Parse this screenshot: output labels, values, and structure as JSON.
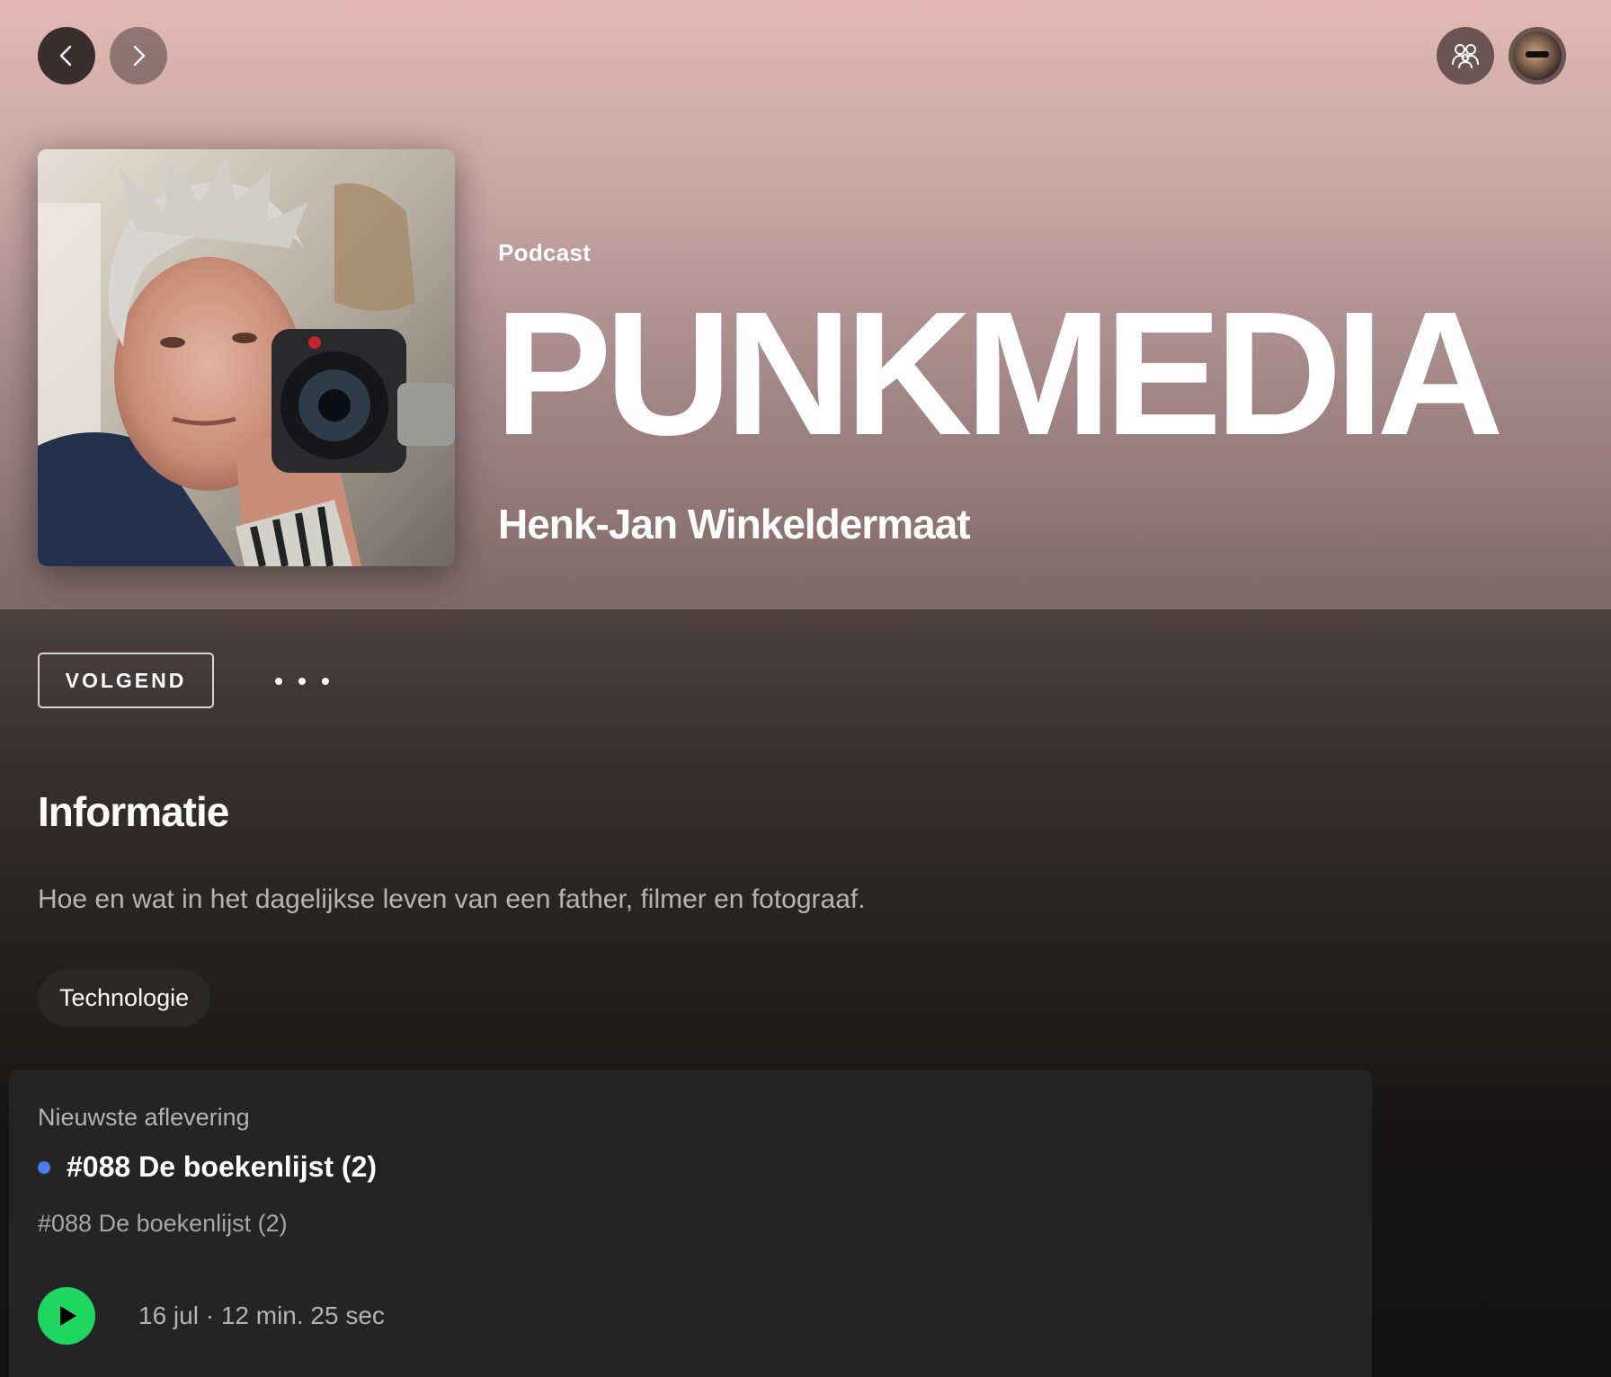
{
  "nav": {
    "back_icon": "chevron-left-icon",
    "forward_icon": "chevron-right-icon",
    "friends_icon": "friends-activity-icon",
    "profile_icon": "user-avatar"
  },
  "header": {
    "type_label": "Podcast",
    "title": "PUNKMEDIA",
    "author": "Henk-Jan Winkeldermaat",
    "gradient_top": "#e3b9b2",
    "gradient_bottom": "#806868"
  },
  "actions": {
    "follow_label": "VOLGEND",
    "more_icon": "more-options-icon"
  },
  "info": {
    "heading": "Informatie",
    "description": "Hoe en wat in het dagelijkse leven van een father, filmer en fotograaf.",
    "category": "Technologie"
  },
  "latest_episode": {
    "caption": "Nieuwste aflevering",
    "title": "#088 De boekenlijst (2)",
    "description": "#088 De boekenlijst (2)",
    "meta": "16 jul · 12 min. 25 sec",
    "new_indicator_color": "#4b7de8",
    "play_icon": "play-icon",
    "play_color": "#1ed760"
  }
}
